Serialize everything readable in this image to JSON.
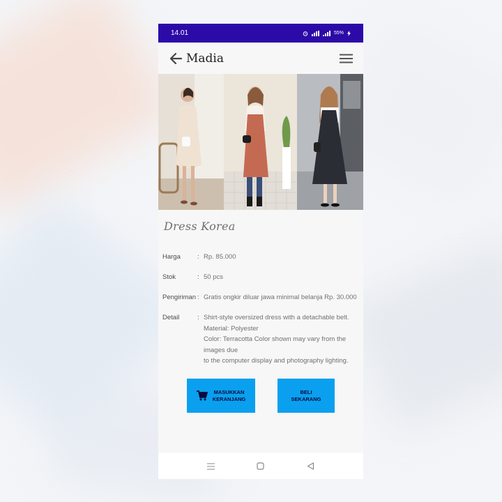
{
  "status_bar": {
    "time": "14.01",
    "battery": "55%"
  },
  "app_bar": {
    "title": "Madia",
    "back_icon": "arrow-left-icon",
    "menu_icon": "hamburger-menu-icon"
  },
  "product": {
    "title": "Dress Korea",
    "price_label": "Harga",
    "price_value": "Rp. 85.000",
    "stock_label": "Stok",
    "stock_value": "50 pcs",
    "shipping_label": "Pengiriman",
    "shipping_value": "Gratis ongkir diluar jawa minimal belanja Rp. 30.000",
    "detail_label": "Detail",
    "detail_lines": [
      "Shirt-style oversized dress with a detachable belt.",
      "Material: Polyester",
      "Color: Terracotta Color shown may vary from the images due",
      "to the computer display and photography lighting."
    ],
    "colon": ":"
  },
  "buttons": {
    "add_to_cart_line1": "MASUKKAN",
    "add_to_cart_line2": "KERANJANG",
    "buy_now_line1": "BELI",
    "buy_now_line2": "SEKARANG"
  },
  "colors": {
    "status_bar": "#2c0aa8",
    "button": "#0aa0ef",
    "button_text": "#0b0b3a"
  }
}
